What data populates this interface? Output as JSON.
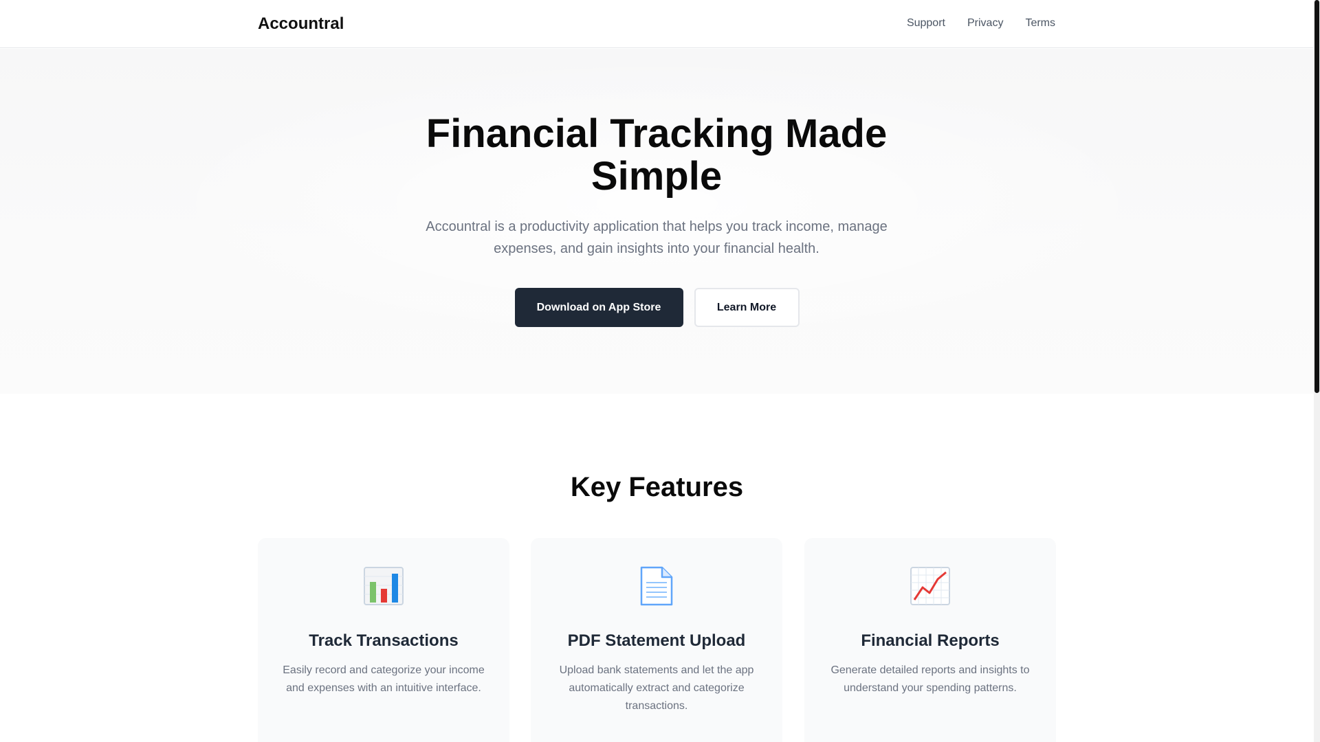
{
  "header": {
    "logo": "Accountral",
    "nav": [
      "Support",
      "Privacy",
      "Terms"
    ]
  },
  "hero": {
    "title": "Financial Tracking Made Simple",
    "subtitle": "Accountral is a productivity application that helps you track income, manage expenses, and gain insights into your financial health.",
    "primary_button": "Download on App Store",
    "secondary_button": "Learn More"
  },
  "features": {
    "title": "Key Features",
    "cards": [
      {
        "icon": "bar-chart-icon",
        "title": "Track Transactions",
        "text": "Easily record and categorize your income and expenses with an intuitive interface."
      },
      {
        "icon": "document-icon",
        "title": "PDF Statement Upload",
        "text": "Upload bank statements and let the app automatically extract and categorize transactions."
      },
      {
        "icon": "trend-chart-icon",
        "title": "Financial Reports",
        "text": "Generate detailed reports and insights to understand your spending patterns."
      }
    ]
  },
  "colors": {
    "primary_button_bg": "#1f2937",
    "text_dark": "#111827",
    "text_muted": "#6b7280",
    "card_bg": "#f9fafb"
  }
}
